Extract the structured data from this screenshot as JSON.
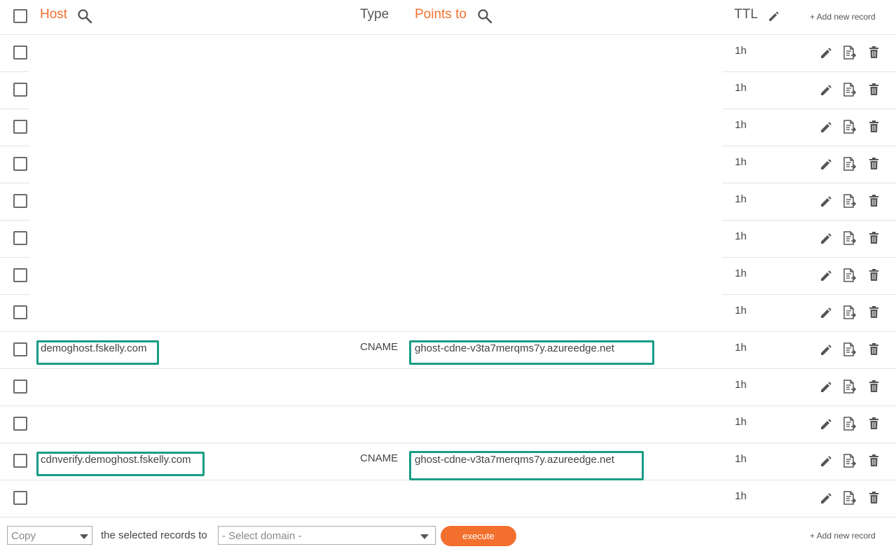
{
  "header": {
    "host_label": "Host",
    "type_label": "Type",
    "points_to_label": "Points to",
    "ttl_label": "TTL",
    "add_record_label": "+ Add new record"
  },
  "records": [
    {
      "host": "",
      "type": "",
      "points_to": "",
      "ttl": "1h"
    },
    {
      "host": "",
      "type": "",
      "points_to": "",
      "ttl": "1h"
    },
    {
      "host": "",
      "type": "",
      "points_to": "",
      "ttl": "1h"
    },
    {
      "host": "",
      "type": "",
      "points_to": "",
      "ttl": "1h"
    },
    {
      "host": "",
      "type": "",
      "points_to": "",
      "ttl": "1h"
    },
    {
      "host": "",
      "type": "",
      "points_to": "",
      "ttl": "1h"
    },
    {
      "host": "",
      "type": "",
      "points_to": "",
      "ttl": "1h"
    },
    {
      "host": "",
      "type": "",
      "points_to": "",
      "ttl": "1h"
    },
    {
      "host": "demoghost.fskelly.com",
      "type": "CNAME",
      "points_to": "ghost-cdne-v3ta7merqms7y.azureedge.net",
      "ttl": "1h"
    },
    {
      "host": "",
      "type": "",
      "points_to": "",
      "ttl": "1h"
    },
    {
      "host": "",
      "type": "",
      "points_to": "",
      "ttl": "1h"
    },
    {
      "host": "cdnverify.demoghost.fskelly.com",
      "type": "CNAME",
      "points_to": "ghost-cdne-v3ta7merqms7y.azureedge.net",
      "ttl": "1h"
    },
    {
      "host": "",
      "type": "",
      "points_to": "",
      "ttl": "1h"
    }
  ],
  "footer": {
    "action_select_value": "Copy",
    "connector_text": "the selected records to",
    "domain_select_value": "- Select domain -",
    "execute_label": "execute",
    "add_record_label": "+ Add new record"
  },
  "colors": {
    "accent_orange": "#f26f2e",
    "highlight_teal": "#1a9c86"
  },
  "icons": {
    "search": "search-icon",
    "edit": "pencil-icon",
    "duplicate": "document-export-icon",
    "delete": "trash-icon"
  }
}
